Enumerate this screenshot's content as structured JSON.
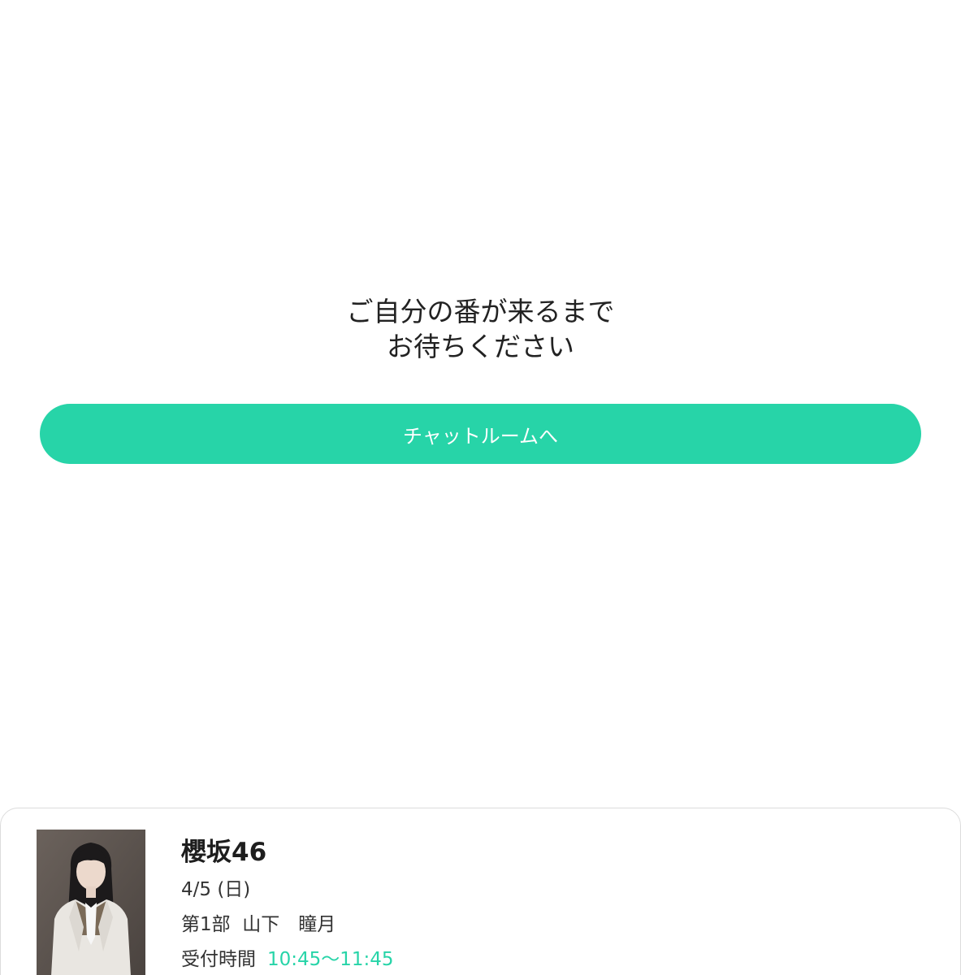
{
  "message": {
    "line1": "ご自分の番が来るまで",
    "line2": "お待ちください"
  },
  "chat_button": {
    "label": "チャットルームへ"
  },
  "event": {
    "group_name": "櫻坂46",
    "date": "4/5 (日)",
    "session": "第1部  山下　瞳月",
    "reception_label": "受付時間",
    "reception_time": "10:45〜11:45"
  },
  "colors": {
    "accent": "#27d4a8",
    "text": "#222222",
    "background": "#ffffff",
    "card_border": "#dcdcdc"
  }
}
